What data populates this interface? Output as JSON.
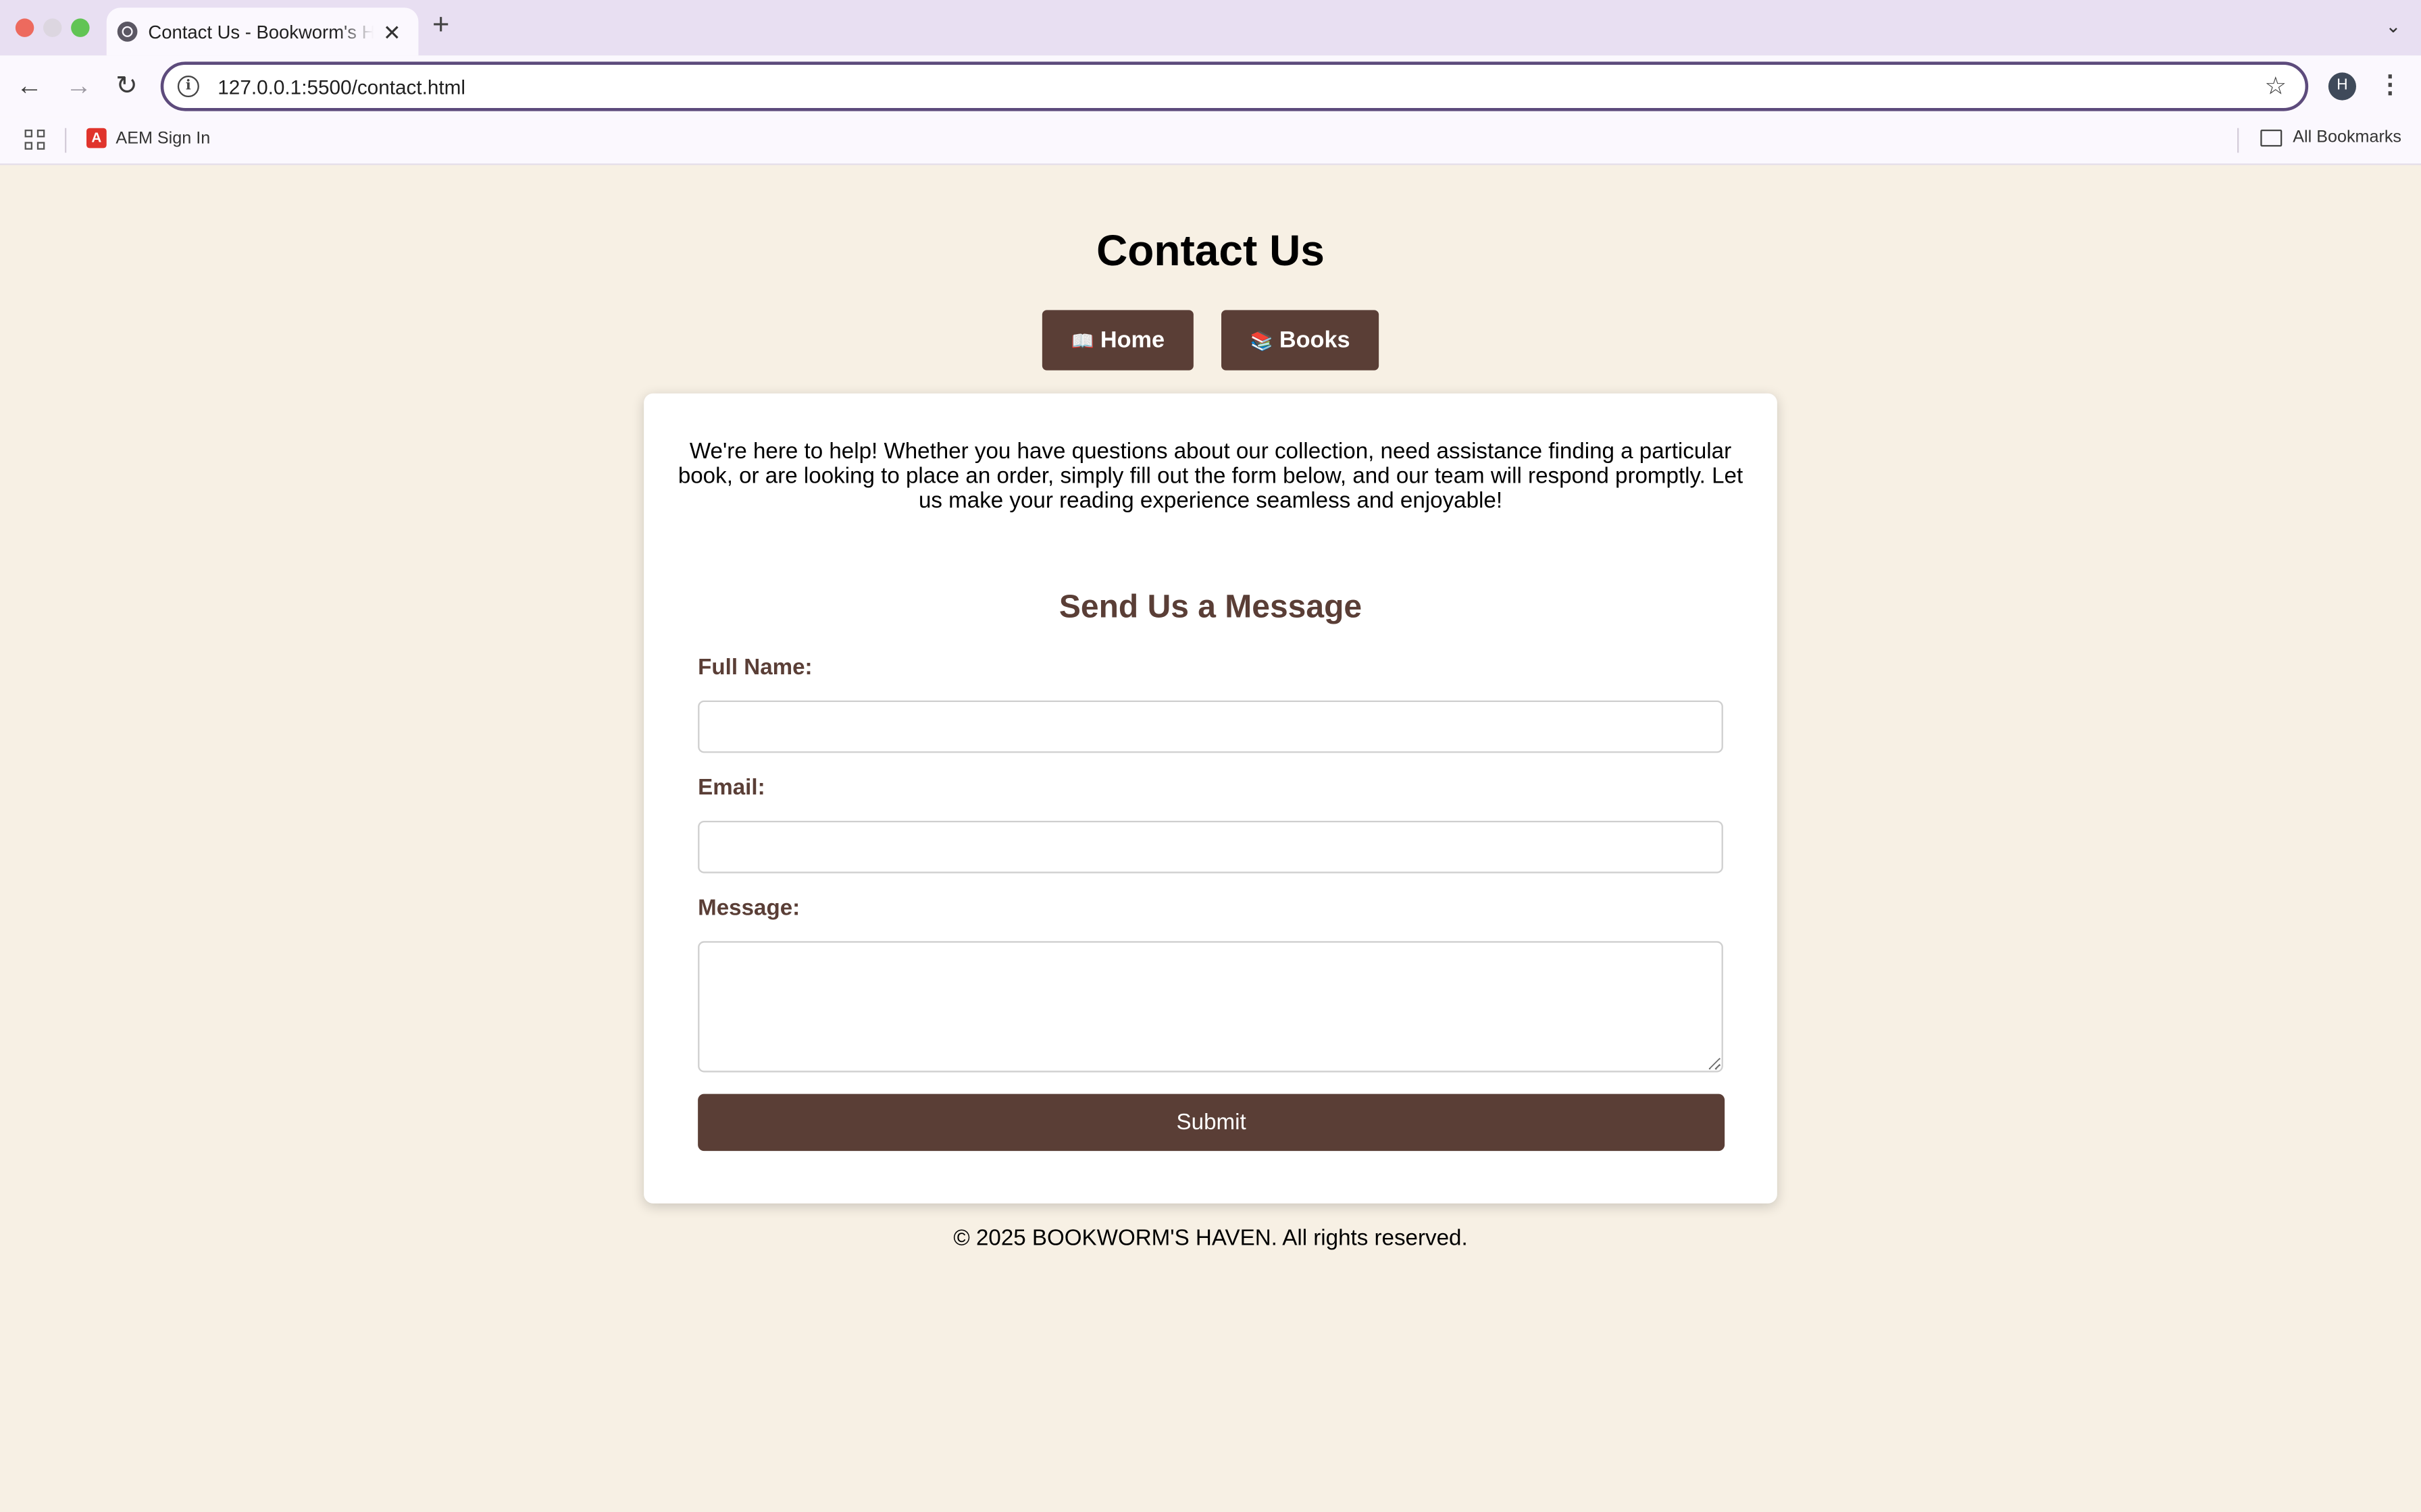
{
  "browser": {
    "tab_title": "Contact Us - Bookworm's Haven",
    "url": "127.0.0.1:5500/contact.html",
    "profile_initial": "H",
    "bookmarks": [
      {
        "label": "AEM Sign In",
        "icon": "aem-icon"
      }
    ],
    "all_bookmarks_label": "All Bookmarks"
  },
  "page": {
    "title": "Contact Us",
    "nav": {
      "home_emoji": "📖",
      "home_label": "Home",
      "books_emoji": "📚",
      "books_label": "Books"
    },
    "intro": "We're here to help! Whether you have questions about our collection, need assistance finding a particular book, or are looking to place an order, simply fill out the form below, and our team will respond promptly. Let us make your reading experience seamless and enjoyable!",
    "form": {
      "title": "Send Us a Message",
      "name_label": "Full Name:",
      "name_value": "",
      "email_label": "Email:",
      "email_value": "",
      "message_label": "Message:",
      "message_value": "",
      "submit_label": "Submit"
    },
    "footer": "© 2025 BOOKWORM'S HAVEN. All rights reserved."
  },
  "colors": {
    "page_bg": "#f7f0e4",
    "accent_brown": "#5a3e36",
    "card_bg": "#ffffff"
  }
}
